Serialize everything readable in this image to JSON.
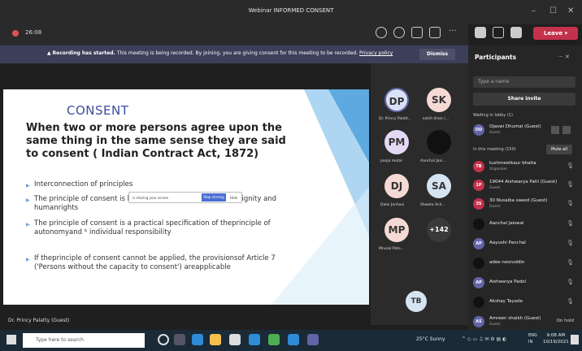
{
  "window": {
    "title": "Webinar INFORMED CONSENT",
    "min": "–",
    "max": "☐",
    "close": "✕"
  },
  "toolbar": {
    "timer": "26:08",
    "leave": "Leave"
  },
  "banner": {
    "text": "Recording has started.",
    "rest": " This meeting is being recorded. By joining, you are giving consent for this meeting to be recorded.",
    "link": "Privacy policy",
    "dismiss": "Dismiss"
  },
  "slide": {
    "title": "CONSENT",
    "heading": "When two or more persons agree upon the same thing in the same sense they are said to consent ( Indian Contract Act, 1872)",
    "bullets": [
      "Interconnection  of  principles",
      "The principle  of  consent  is  based  on theprinciple  of  humandignity   and    humanrights",
      "The principle  of  consent  is  a  practical  specification of theprinciple  of  autonomyand  ᵇ individual responsibility",
      "If   theprinciple of  consent  cannot   be applied,  the provisionsof  Article   7  ('Persons without   the capacity  to        consent') areapplicable"
    ],
    "sharebar": "  is sharing your screen",
    "stop": "Stop sharing",
    "hide": "Hide"
  },
  "presenter": "Dr. Princy Palatty (Guest)",
  "gallery": [
    {
      "initials": "DP",
      "name": "Dr. Princy Palatt...",
      "color": "#d9e2f5"
    },
    {
      "initials": "SK",
      "name": "sahih khan (...",
      "color": "#f5d9d4"
    },
    {
      "initials": "PM",
      "name": "pooja motar",
      "color": "#e3d9f5"
    },
    {
      "initials": "",
      "name": "Aanchal Jais...",
      "color": "#111111"
    },
    {
      "initials": "DJ",
      "name": "Dalei Janhavi",
      "color": "#f5d9d4"
    },
    {
      "initials": "SA",
      "name": "Shweta Ach...",
      "color": "#d6e4f2"
    },
    {
      "initials": "MP",
      "name": "Mrunal Pato...",
      "color": "#f5d9d4"
    },
    {
      "initials": "+142",
      "name": "",
      "color": "#3a3a3a"
    },
    {
      "initials": "TB",
      "name": "",
      "color": "#d6e4f2"
    }
  ],
  "participants": {
    "title": "Participants",
    "search": "Type a name",
    "share_invite": "Share invite",
    "lobby_label": "Waiting in lobby (1)",
    "meeting_label": "In this meeting (150)",
    "mute_all": "Mute all",
    "lobby": [
      {
        "initials": "OD",
        "name": "Ojaswi Dhumal (Guest)",
        "sub": "Guest",
        "color": "#6264a7"
      }
    ],
    "people": [
      {
        "initials": "TB",
        "name": "tushmeetkaur bhatia",
        "sub": "Organizer",
        "color": "#c4314b"
      },
      {
        "initials": "1P",
        "name": "19044 Aishwarya Patil (Guest)",
        "sub": "Guest",
        "color": "#c4314b"
      },
      {
        "initials": "3S",
        "name": "30 Nusaiba saeed (Guest)",
        "sub": "Guest",
        "color": "#c4314b"
      },
      {
        "initials": "",
        "name": "Aanchal Jaiswal",
        "sub": "",
        "color": "#111111"
      },
      {
        "initials": "AP",
        "name": "Aayushi Panchal",
        "sub": "",
        "color": "#6264a7"
      },
      {
        "initials": "",
        "name": "adee nooruddin",
        "sub": "",
        "color": "#111111"
      },
      {
        "initials": "AP",
        "name": "Aishwarya Padol",
        "sub": "",
        "color": "#6264a7"
      },
      {
        "initials": "",
        "name": "Akshay Tayade",
        "sub": "",
        "color": "#111111"
      },
      {
        "initials": "AS",
        "name": "Amreen shaikh (Guest)",
        "sub": "Guest",
        "color": "#6264a7"
      }
    ],
    "on_hold": "On hold"
  },
  "taskbar": {
    "search": "Type here to search",
    "weather": "25°C  Sunny",
    "lang1": "ENG",
    "lang2": "IN",
    "time": "9:08 AM",
    "date": "10/19/2021"
  }
}
